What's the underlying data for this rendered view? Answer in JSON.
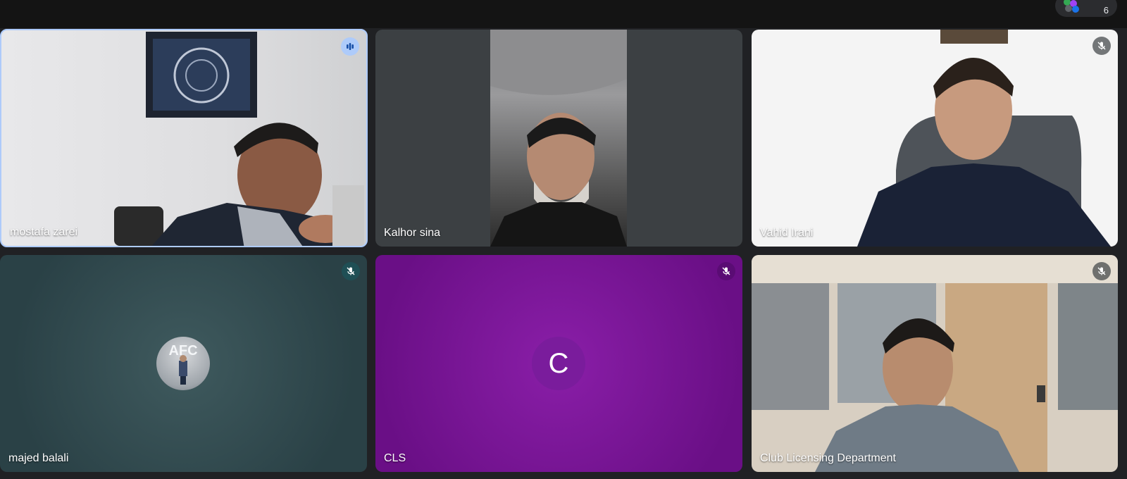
{
  "header": {
    "people_count": "6",
    "avatar_colors": [
      "#34a853",
      "#a142f4",
      "#5f6368",
      "#1a73e8"
    ]
  },
  "participants": [
    {
      "name": "mostafa zarei",
      "status": "speaking",
      "video": true
    },
    {
      "name": "Kalhor sina",
      "status": "none",
      "video": true
    },
    {
      "name": "Vahid Irani",
      "status": "muted",
      "video": true
    },
    {
      "name": "majed balali",
      "status": "muted",
      "video": false,
      "avatar": "photo"
    },
    {
      "name": "CLS",
      "status": "muted",
      "video": false,
      "avatar_letter": "C",
      "tile_color": "#6a0f86"
    },
    {
      "name": "Club Licensing Department",
      "status": "muted",
      "video": true
    }
  ],
  "colors": {
    "active_speaker_border": "#aecbfa",
    "background": "#202124",
    "tile_dark": "#3c4043"
  }
}
